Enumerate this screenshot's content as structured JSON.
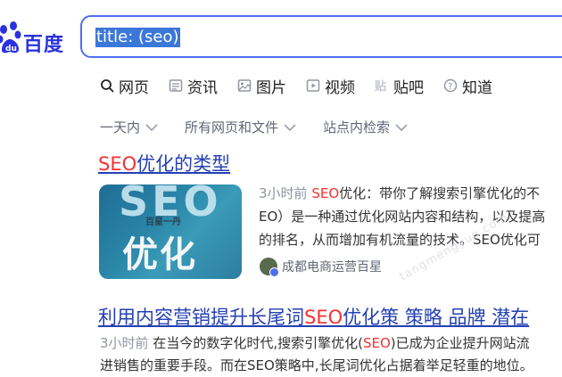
{
  "header": {
    "brand_text": "百度",
    "brand_color": "#2932e1",
    "search": {
      "query": "title: (seo)",
      "border_color": "#4e6ef2"
    }
  },
  "tabs": [
    {
      "label": "网页",
      "icon": "search-icon",
      "active": true
    },
    {
      "label": "资讯",
      "icon": "news-icon"
    },
    {
      "label": "图片",
      "icon": "image-icon"
    },
    {
      "label": "视频",
      "icon": "video-icon"
    },
    {
      "label": "贴吧",
      "icon": "tieba-icon"
    },
    {
      "label": "知道",
      "icon": "question-icon"
    }
  ],
  "filters": [
    {
      "label": "一天内"
    },
    {
      "label": "所有网页和文件"
    },
    {
      "label": "站点内检索"
    }
  ],
  "results": [
    {
      "title_hl": "SEO",
      "title_rest": "优化的类型",
      "thumb": {
        "big_text": "SEO",
        "small_text": "百星一丹",
        "big_text_2": "优化"
      },
      "time": "3小时前",
      "line1_hl": "SEO",
      "line1_rest": "优化：带你了解搜索引擎优化的不",
      "line2": "EO）是一种通过优化网站内容和结构，以及提高",
      "line3": "的排名，从而增加有机流量的技术。SEO优化可",
      "source": "成都电商运营百星"
    },
    {
      "title_pre": "利用内容营销提升长尾词",
      "title_hl": "SEO",
      "title_rest": "优化策 策略 品牌 潜在",
      "time": "3小时前",
      "line1_pre": "在当今的数字化时代,搜索引擎优化(",
      "line1_hl": "SEO",
      "line1_rest": ")已成为企业提升网站流",
      "line2": "进销售的重要手段。而在SEO策略中,长尾词优化占据着举足轻重的地位。"
    }
  ],
  "watermark": "tangmengyun.com",
  "highlight_color": "#f73131",
  "link_color": "#2440b3"
}
